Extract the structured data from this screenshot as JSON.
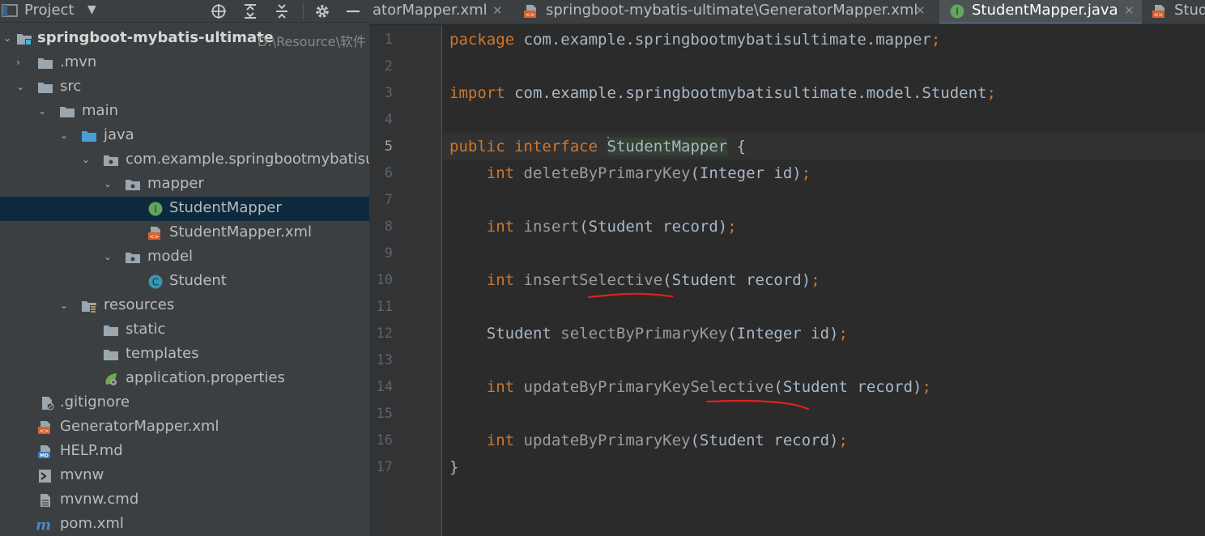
{
  "project_panel": {
    "title": "Project",
    "tree": [
      {
        "label": "springboot-mybatis-ultimate",
        "path": "D:\\Resource\\软件",
        "bold": true
      },
      {
        "label": ".mvn"
      },
      {
        "label": "src"
      },
      {
        "label": "main"
      },
      {
        "label": "java"
      },
      {
        "label": "com.example.springbootmybatisultimate"
      },
      {
        "label": "mapper"
      },
      {
        "label": "StudentMapper"
      },
      {
        "label": "StudentMapper.xml"
      },
      {
        "label": "model"
      },
      {
        "label": "Student"
      },
      {
        "label": "resources"
      },
      {
        "label": "static"
      },
      {
        "label": "templates"
      },
      {
        "label": "application.properties"
      },
      {
        "label": ".gitignore"
      },
      {
        "label": "GeneratorMapper.xml"
      },
      {
        "label": "HELP.md"
      },
      {
        "label": "mvnw"
      },
      {
        "label": "mvnw.cmd"
      },
      {
        "label": "pom.xml"
      }
    ]
  },
  "tabs": [
    {
      "label": "atorMapper.xml"
    },
    {
      "label": "springboot-mybatis-ultimate\\GeneratorMapper.xml"
    },
    {
      "label": "StudentMapper.java",
      "active": true
    },
    {
      "label": "Stud"
    }
  ],
  "editor": {
    "line_numbers": [
      "1",
      "2",
      "3",
      "4",
      "5",
      "6",
      "7",
      "8",
      "9",
      "10",
      "11",
      "12",
      "13",
      "14",
      "15",
      "16",
      "17"
    ],
    "current_line": 5,
    "code": {
      "l1_kw": "package",
      "l1_rest": " com.example.springbootmybatisultimate.mapper",
      "l3_kw": "import",
      "l3_rest": " com.example.springbootmybatisultimate.model.Student",
      "semi": ";",
      "l5_kw1": "public",
      "l5_kw2": "interface",
      "l5_name_first": "S",
      "l5_name_rest": "tudentMapper",
      "l5_brace": " {",
      "t_int": "int",
      "t_student": "Student",
      "t_integer": "Integer",
      "p_id": " id)",
      "p_record": " record)",
      "m_delete": "deleteByPrimaryKey",
      "m_insert": "insert",
      "m_insert_sel": "insertSelective",
      "m_select": "selectByPrimaryKey",
      "m_update_sel": "updateByPrimaryKeySelective",
      "m_update": "updateByPrimaryKey",
      "open_paren": "(",
      "close_brace": "}"
    },
    "annotation_color": "#e02020"
  },
  "colors": {
    "keyword": "#cc7832",
    "method": "#9c9c9c",
    "text": "#a9b7c6",
    "selection": "#0d293e",
    "tab_underline": "#4a88c7"
  }
}
